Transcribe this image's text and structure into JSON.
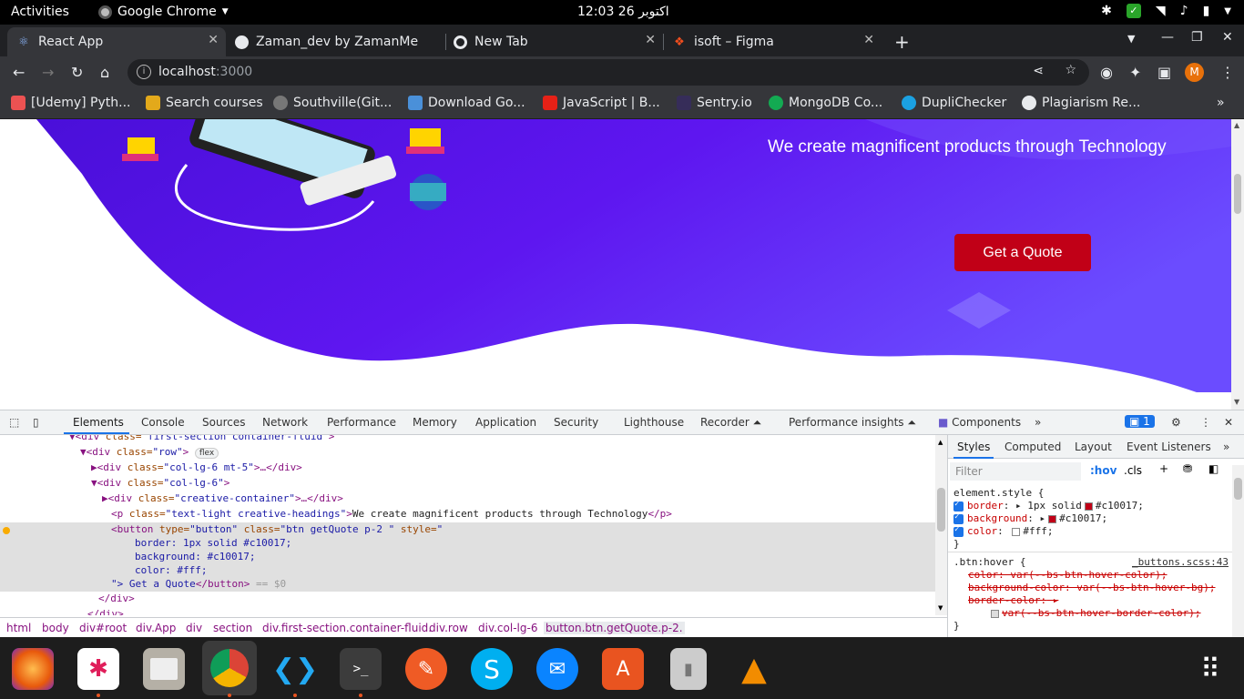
{
  "topbar": {
    "activities": "Activities",
    "app": "Google Chrome",
    "clock": "12:03  26 اکتوبر"
  },
  "tabs": [
    {
      "title": "React App",
      "icon": "react-icon"
    },
    {
      "title": "Zaman_dev by ZamanMe",
      "icon": "github-icon"
    },
    {
      "title": "New Tab",
      "icon": "chrome-icon"
    },
    {
      "title": "isoft – Figma",
      "icon": "figma-icon"
    }
  ],
  "addressbar": {
    "host": "localhost",
    "port": ":3000"
  },
  "bookmarks": [
    {
      "label": "[Udemy] Pyth...",
      "color": "#ec5252"
    },
    {
      "label": "Search courses",
      "color": "#e3a91b"
    },
    {
      "label": "Southville(Git...",
      "color": "#777777"
    },
    {
      "label": "Download Go...",
      "color": "#4a90d9"
    },
    {
      "label": "JavaScript | B...",
      "color": "#e62117"
    },
    {
      "label": "Sentry.io",
      "color": "#362d59"
    },
    {
      "label": "MongoDB Co...",
      "color": "#13aa52"
    },
    {
      "label": "DupliChecker",
      "color": "#1ba1e2"
    },
    {
      "label": "Plagiarism Re...",
      "color": "#e8eaed"
    }
  ],
  "page": {
    "heading": "We create magnificent products through Technology",
    "button": "Get a Quote",
    "accent": "#c10017"
  },
  "devtools": {
    "tabs": [
      "Elements",
      "Console",
      "Sources",
      "Network",
      "Performance",
      "Memory",
      "Application",
      "Security",
      "Lighthouse",
      "Recorder ⏶",
      "Performance insights ⏶",
      "Components"
    ],
    "issues": "1",
    "dom": {
      "l0a": "div",
      "l0b": " class=",
      "l0c": "\"first-section container-fluid\"",
      "l0d": ">",
      "l1": "div",
      "l1attr": " class=",
      "l1val": "\"row\"",
      "l1badge": "flex",
      "l2": "div",
      "l2val": "\"col-lg-6 mt-5\"",
      "l3": "div",
      "l3val": "\"col-lg-6\"",
      "l4": "div",
      "l4val": "\"creative-container\"",
      "l5": "p",
      "l5val": "\"text-light creative-headings\"",
      "l5text": "We create magnificent products through Technology",
      "l6": "button",
      "l6a": " type=",
      "l6b": "\"button\"",
      "l6c": " class=",
      "l6d": "\"btn getQuote p-2 \"",
      "l6e": " style=",
      "l6f": "\"",
      "l7": "border: 1px solid #c10017;",
      "l8": "background: #c10017;",
      "l9": "color: #fff;",
      "l10a": "\"> Get a Quote",
      "l10b": "</button>",
      "l10c": " == $0",
      "l11": "</div>",
      "l12": "</div>"
    },
    "styleTabs": [
      "Styles",
      "Computed",
      "Layout",
      "Event Listeners"
    ],
    "filter": "Filter",
    "hov": ":hov",
    "cls": ".cls",
    "styles": {
      "element": "element.style {",
      "p1": "border",
      "v1": "1px solid",
      "c1": "#c10017;",
      "p2": "background",
      "c2": "#c10017;",
      "p3": "color",
      "c3": "#fff;",
      "close": "}",
      "hover": ".btn:hover {",
      "src": "_buttons.scss:43",
      "s1": "color: var(--bs-btn-hover-color);",
      "s2": "background-color: var(--bs-btn-hover-bg);",
      "s3": "border-color:",
      "s4": "var(--bs-btn-hover-border-color);"
    },
    "breadcrumb": [
      "html",
      "body",
      "div#root",
      "div.App",
      "div",
      "section",
      "div.first-section.container-fluid.",
      "div.row",
      "div.col-lg-6",
      "button.btn.getQuote.p-2."
    ]
  },
  "dock": [
    "firefox-icon",
    "slack-icon",
    "files-icon",
    "chrome-icon",
    "vscode-icon",
    "terminal-icon",
    "postman-icon",
    "skype-icon",
    "thunderbird-icon",
    "appcenter-icon",
    "archive-icon",
    "vlc-icon",
    "app-grid-icon"
  ]
}
